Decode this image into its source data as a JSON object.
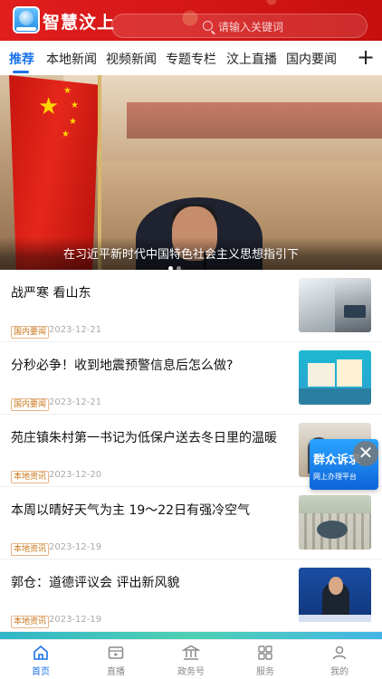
{
  "header": {
    "brand": "智慧汶上",
    "search_placeholder": "请输入关键词"
  },
  "tabs": [
    "推荐",
    "本地新闻",
    "视频新闻",
    "专题专栏",
    "汶上直播",
    "国内要闻"
  ],
  "tabs_add_label": "+",
  "hero": {
    "caption": "在习近平新时代中国特色社会主义思想指引下"
  },
  "news": [
    {
      "title": "战严寒  看山东",
      "badge": "国内要闻",
      "date": "2023-12-21"
    },
    {
      "title": "分秒必争！收到地震预警信息后怎么做?",
      "badge": "国内要闻",
      "date": "2023-12-21"
    },
    {
      "title": "苑庄镇朱村第一书记为低保户送去冬日里的温暖",
      "badge": "本地资讯",
      "date": "2023-12-20"
    },
    {
      "title": "本周以晴好天气为主  19～22日有强冷空气",
      "badge": "本地资讯",
      "date": "2023-12-19"
    },
    {
      "title": "郭仓：道德评议会  评出新风貌",
      "badge": "本地资讯",
      "date": "2023-12-19"
    }
  ],
  "float_widget": {
    "title": "群众诉求",
    "subtitle": "网上办理平台",
    "close": "✕"
  },
  "nav": [
    {
      "label": "首页",
      "icon": "home-icon",
      "active": true
    },
    {
      "label": "直播",
      "icon": "video-icon"
    },
    {
      "label": "政务号",
      "icon": "government-icon"
    },
    {
      "label": "服务",
      "icon": "grid-icon"
    },
    {
      "label": "我的",
      "icon": "user-icon"
    }
  ],
  "colors": {
    "accent": "#1a73e8",
    "header_red": "#d31616",
    "badge": "#c9751a"
  }
}
